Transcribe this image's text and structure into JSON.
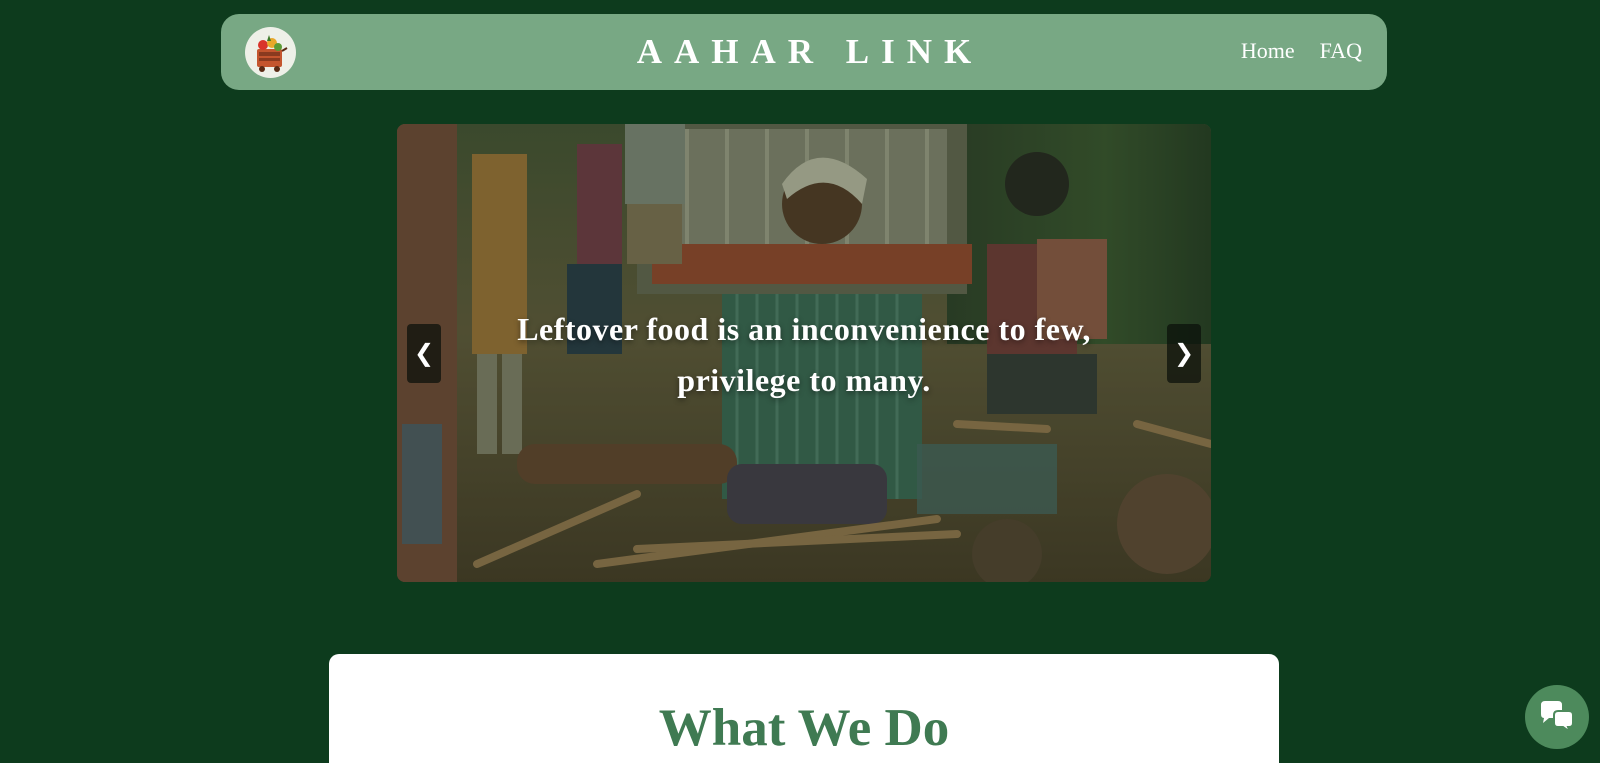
{
  "navbar": {
    "logo_icon": "food-cart-logo-icon",
    "brand_title": "AAHAR LINK",
    "links": [
      {
        "label": "Home"
      },
      {
        "label": "FAQ"
      }
    ]
  },
  "carousel": {
    "caption": "Leftover food is an inconvenience to few, privilege to many.",
    "prev_icon": "chevron-left-icon",
    "prev_label": "❮",
    "next_icon": "chevron-right-icon",
    "next_label": "❯",
    "image_description_icon": "carousel-photo"
  },
  "what_we_do": {
    "title": "What We Do"
  },
  "chat": {
    "icon": "chat-bubbles-icon"
  },
  "colors": {
    "page_background": "#0d3b1d",
    "navbar_background": "#78a884",
    "accent_green": "#3f7a52",
    "chat_button": "#4d8a5c"
  }
}
